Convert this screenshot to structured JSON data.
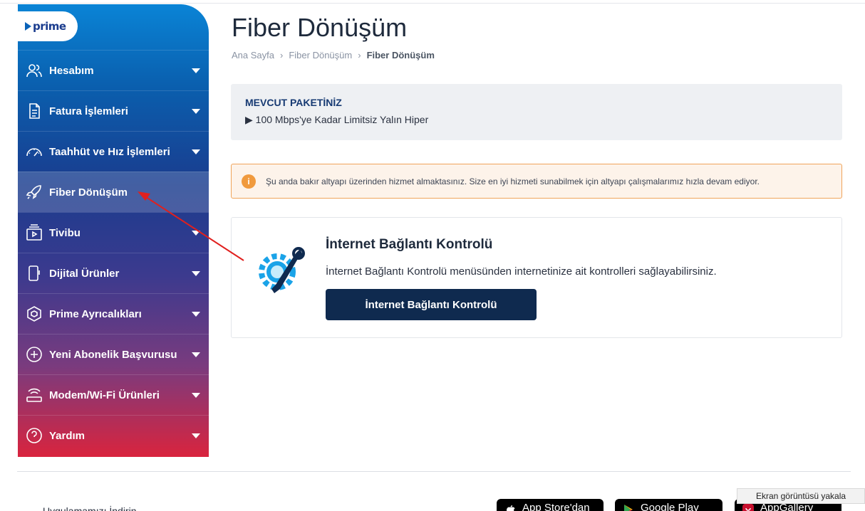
{
  "sidebar": {
    "logo_text": "prime",
    "items": [
      {
        "label": "Hesabım",
        "icon": "user-icon"
      },
      {
        "label": "Fatura İşlemleri",
        "icon": "document-icon"
      },
      {
        "label": "Taahhüt ve Hız İşlemleri",
        "icon": "speedometer-icon"
      },
      {
        "label": "Fiber Dönüşüm",
        "icon": "rocket-icon"
      },
      {
        "label": "Tivibu",
        "icon": "tv-play-icon"
      },
      {
        "label": "Dijital Ürünler",
        "icon": "phone-icon"
      },
      {
        "label": "Prime Ayrıcalıkları",
        "icon": "cube-icon"
      },
      {
        "label": "Yeni Abonelik Başvurusu",
        "icon": "plus-circle-icon"
      },
      {
        "label": "Modem/Wi-Fi Ürünleri",
        "icon": "modem-icon"
      },
      {
        "label": "Yardım",
        "icon": "help-icon"
      }
    ]
  },
  "page": {
    "title": "Fiber Dönüşüm",
    "breadcrumb": [
      "Ana Sayfa",
      "Fiber Dönüşüm",
      "Fiber Dönüşüm"
    ]
  },
  "package": {
    "title": "MEVCUT PAKETİNİZ",
    "value": "▶ 100 Mbps'ye Kadar Limitsiz Yalın Hiper"
  },
  "alert": {
    "icon_text": "i",
    "text": "Şu anda bakır altyapı üzerinden hizmet almaktasınız. Size en iyi hizmeti sunabilmek için altyapı çalışmalarımız hızla devam ediyor."
  },
  "card": {
    "title": "İnternet Bağlantı Kontrolü",
    "description": "İnternet Bağlantı Kontrolü menüsünden internetinize ait kontrolleri sağlayabilirsiniz.",
    "button_label": "İnternet Bağlantı Kontrolü"
  },
  "footer": {
    "app_text": "Uygulamamızı İndirin",
    "stores": [
      "App Store'dan",
      "Google Play",
      "AppGallery"
    ]
  },
  "tooltip": "Ekran görüntüsü yakala",
  "colors": {
    "accent_navy": "#0f2a4f",
    "alert_orange": "#f09a3e",
    "arrow_red": "#e0201e"
  }
}
